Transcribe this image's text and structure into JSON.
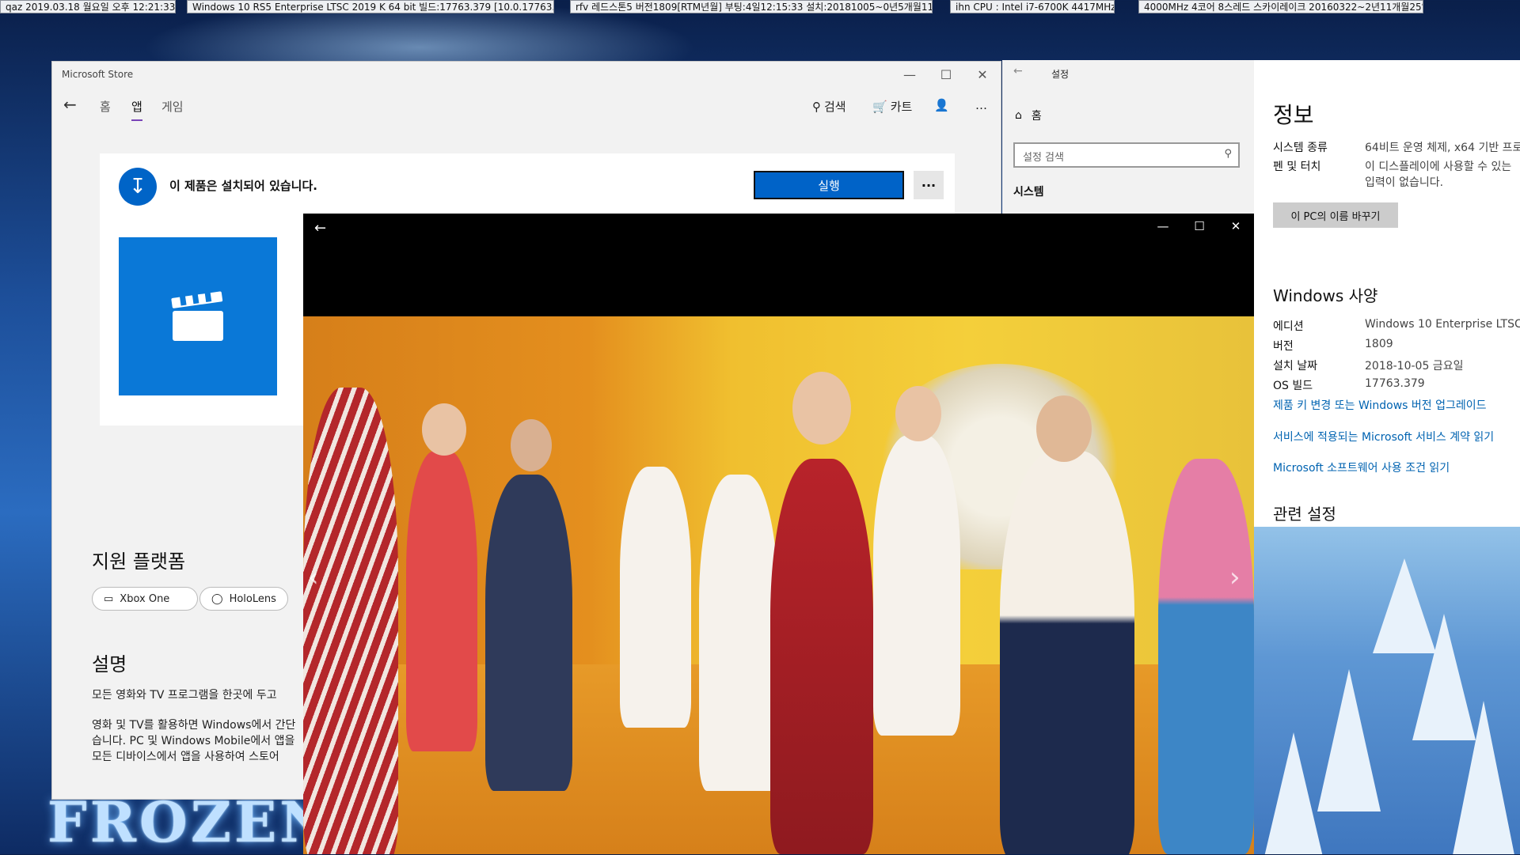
{
  "topbar": {
    "chips": [
      {
        "label": "qaz",
        "text": "2019.03.18 월요일 오후 12:21:33"
      },
      {
        "label": "",
        "text": "Windows 10 RS5 Enterprise LTSC 2019 K 64 bit 빌드:17763.379 [10.0.17763.379]"
      },
      {
        "label": "rfv",
        "text": "레드스톤5 버전1809[RTM년월] 부팅:4일12:15:33 설치:20181005~0년5개월11일"
      },
      {
        "label": "ihn",
        "text": "CPU : Intel i7-6700K 4417MHz"
      },
      {
        "label": "",
        "text": "4000MHz 4코어 8스레드 스카이레이크 20160322~2년11개월25일"
      }
    ]
  },
  "store": {
    "title": "Microsoft Store",
    "nav": {
      "home": "홈",
      "apps": "앱",
      "games": "게임",
      "search": "검색",
      "cart": "카트",
      "more": "…"
    },
    "banner": {
      "message": "이 제품은 설치되어 있습니다.",
      "run": "실행",
      "more": "···"
    },
    "platforms_title": "지원 플랫폼",
    "platforms": [
      "Xbox One",
      "HoloLens"
    ],
    "description_title": "설명",
    "description_lines": [
      "모든 영화와 TV 프로그램을 한곳에 두고",
      "영화 및 TV를 활용하면 Windows에서 간단",
      "습니다. PC 및 Windows Mobile에서 앱을",
      "모든 디바이스에서 앱을 사용하여 스토어"
    ]
  },
  "settings": {
    "title": "설정",
    "home": "홈",
    "search_placeholder": "설정 검색",
    "category": "시스템",
    "info_title": "정보",
    "rows_top": [
      {
        "label": "시스템 종류",
        "value": "64비트 운영 체제, x64 기반 프로"
      },
      {
        "label": "펜 및 터치",
        "value": "이 디스플레이에 사용할 수 있는"
      },
      {
        "label": "",
        "value": "입력이 없습니다."
      }
    ],
    "rename_button": "이 PC의 이름 바꾸기",
    "spec_title": "Windows 사양",
    "rows_spec": [
      {
        "label": "에디션",
        "value": "Windows 10 Enterprise LTSC"
      },
      {
        "label": "버전",
        "value": "1809"
      },
      {
        "label": "설치 날짜",
        "value": "2018-10-05 금요일"
      },
      {
        "label": "OS 빌드",
        "value": "17763.379"
      }
    ],
    "links": [
      "제품 키 변경 또는 Windows 버전 업그레이드",
      "서비스에 적용되는 Microsoft 서비스 계약 읽기",
      "Microsoft 소프트웨어 사용 조건 읽기"
    ],
    "related_title": "관련 설정"
  },
  "wallpaper": {
    "logo": "FROZEN"
  },
  "colors": {
    "accent": "#0063c8",
    "link": "#0063b1",
    "tab_indicator": "#7a44b8"
  }
}
